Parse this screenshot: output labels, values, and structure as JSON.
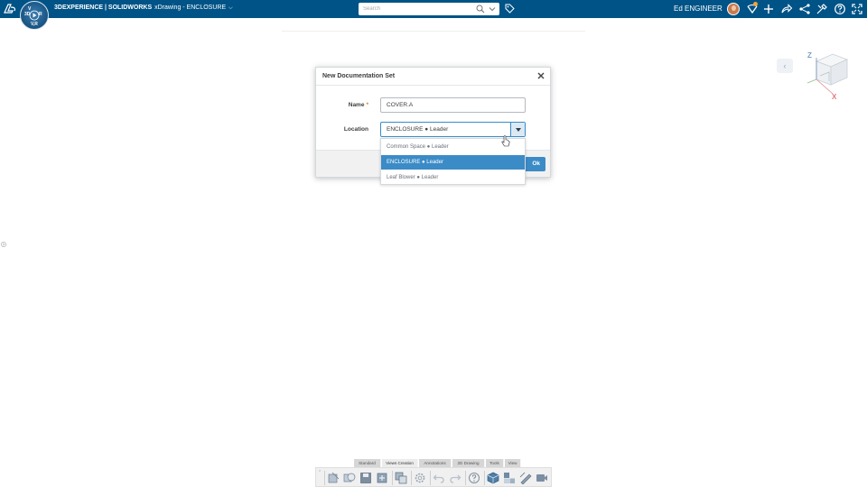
{
  "header": {
    "brand_bold": "3DEXPERIENCE | SOLIDWORKS",
    "app_title": "xDrawing - ENCLOSURE",
    "search_placeholder": "Search",
    "user_name": "Ed ENGINEER",
    "compass_labels": {
      "top": "3D",
      "left": "V",
      "right": "R",
      "bottom": "V,R"
    }
  },
  "dialog": {
    "title": "New Documentation Set",
    "name_label": "Name",
    "required_mark": "*",
    "name_value": "COVER.A",
    "location_label": "Location",
    "location_value": "ENCLOSURE ● Leader",
    "ok_label": "Ok",
    "options": [
      {
        "label": "Common Space ● Leader",
        "selected": false
      },
      {
        "label": "ENCLOSURE ● Leader",
        "selected": true
      },
      {
        "label": "Leaf Blower ● Leader",
        "selected": false
      }
    ]
  },
  "view_cube": {
    "axis_z": "Z",
    "axis_x": "X"
  },
  "toolbar_tabs": [
    {
      "label": "Standard",
      "active": false
    },
    {
      "label": "Views Creation",
      "active": true
    },
    {
      "label": "Annotations",
      "active": false
    },
    {
      "label": "2D Drawing",
      "active": false
    },
    {
      "label": "Tools",
      "active": false
    },
    {
      "label": "View",
      "active": false
    }
  ],
  "colors": {
    "topbar": "#005386",
    "accent": "#3b8bc7",
    "required": "#e87a1d"
  }
}
